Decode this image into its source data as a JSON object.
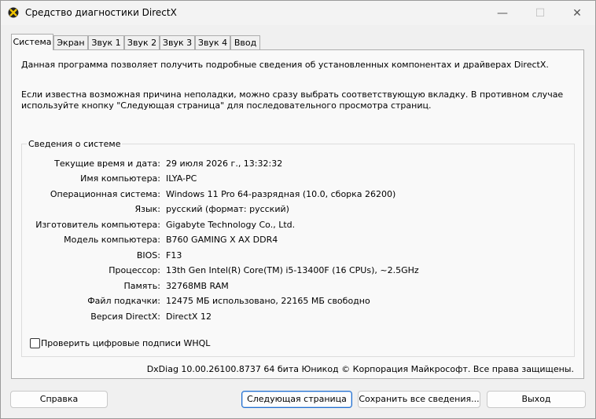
{
  "window": {
    "title": "Средство диагностики DirectX",
    "minimize": "—",
    "maximize": "☐",
    "close": "✕"
  },
  "tabs": [
    "Система",
    "Экран",
    "Звук 1",
    "Звук 2",
    "Звук 3",
    "Звук 4",
    "Ввод"
  ],
  "active_tab": "Система",
  "intro": {
    "line1": "Данная программа позволяет получить подробные сведения об установленных компонентах и драйверах DirectX.",
    "line2": "Если известна возможная причина неполадки, можно сразу выбрать соответствующую вкладку. В противном случае используйте кнопку \"Следующая страница\" для последовательного просмотра страниц."
  },
  "system_info": {
    "group_title": "Сведения о системе",
    "rows": [
      {
        "label": "Текущие время и дата:",
        "value": "29 июля 2026 г., 13:32:32"
      },
      {
        "label": "Имя компьютера:",
        "value": "ILYA-PC"
      },
      {
        "label": "Операционная система:",
        "value": "Windows 11 Pro 64-разрядная (10.0, сборка 26200)"
      },
      {
        "label": "Язык:",
        "value": "русский (формат: русский)"
      },
      {
        "label": "Изготовитель компьютера:",
        "value": "Gigabyte Technology Co., Ltd."
      },
      {
        "label": "Модель компьютера:",
        "value": "B760 GAMING X AX DDR4"
      },
      {
        "label": "BIOS:",
        "value": "F13"
      },
      {
        "label": "Процессор:",
        "value": "13th Gen Intel(R) Core(TM) i5-13400F (16 CPUs), ~2.5GHz"
      },
      {
        "label": "Память:",
        "value": "32768MB RAM"
      },
      {
        "label": "Файл подкачки:",
        "value": "12475 МБ использовано, 22165 МБ свободно"
      },
      {
        "label": "Версия DirectX:",
        "value": "DirectX 12"
      }
    ]
  },
  "whql_checkbox": {
    "label": "Проверить цифровые подписи WHQL",
    "checked": false
  },
  "footer_text": "DxDiag 10.00.26100.8737 64 бита Юникод  © Корпорация Майкрософт. Все права защищены.",
  "buttons": {
    "help": "Справка",
    "next_page": "Следующая страница",
    "save_all": "Сохранить все сведения...",
    "exit": "Выход"
  },
  "colors": {
    "accent": "#1f6fd0",
    "window_bg": "#f0f0f0",
    "panel_bg": "#f9f9f9"
  }
}
